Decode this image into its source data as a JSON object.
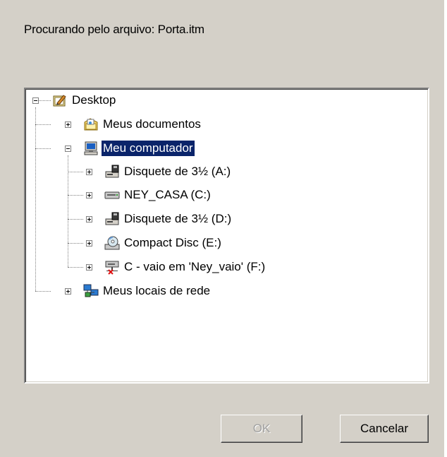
{
  "dialog": {
    "prompt": "Procurando pelo arquivo: Porta.itm"
  },
  "tree": {
    "root": {
      "label": "Desktop",
      "icon": "desktop-icon",
      "expanded": true
    },
    "items": [
      {
        "label": "Meus documentos",
        "icon": "my-documents-icon",
        "expander": "plus"
      },
      {
        "label": "Meu computador",
        "icon": "my-computer-icon",
        "expander": "minus",
        "selected": true
      },
      {
        "label": "Disquete de 3½ (A:)",
        "icon": "floppy-drive-icon",
        "expander": "plus"
      },
      {
        "label": "NEY_CASA (C:)",
        "icon": "hard-drive-icon",
        "expander": "plus"
      },
      {
        "label": "Disquete de 3½ (D:)",
        "icon": "floppy-drive-icon",
        "expander": "plus"
      },
      {
        "label": "Compact Disc (E:)",
        "icon": "cd-drive-icon",
        "expander": "plus"
      },
      {
        "label": "C - vaio em 'Ney_vaio' (F:)",
        "icon": "network-drive-disconnected-icon",
        "expander": "plus"
      },
      {
        "label": "Meus locais de rede",
        "icon": "network-places-icon",
        "expander": "plus"
      }
    ]
  },
  "buttons": {
    "ok": "OK",
    "cancel": "Cancelar"
  },
  "colors": {
    "dialog_bg": "#d4d0c8",
    "selection": "#0a246a"
  }
}
